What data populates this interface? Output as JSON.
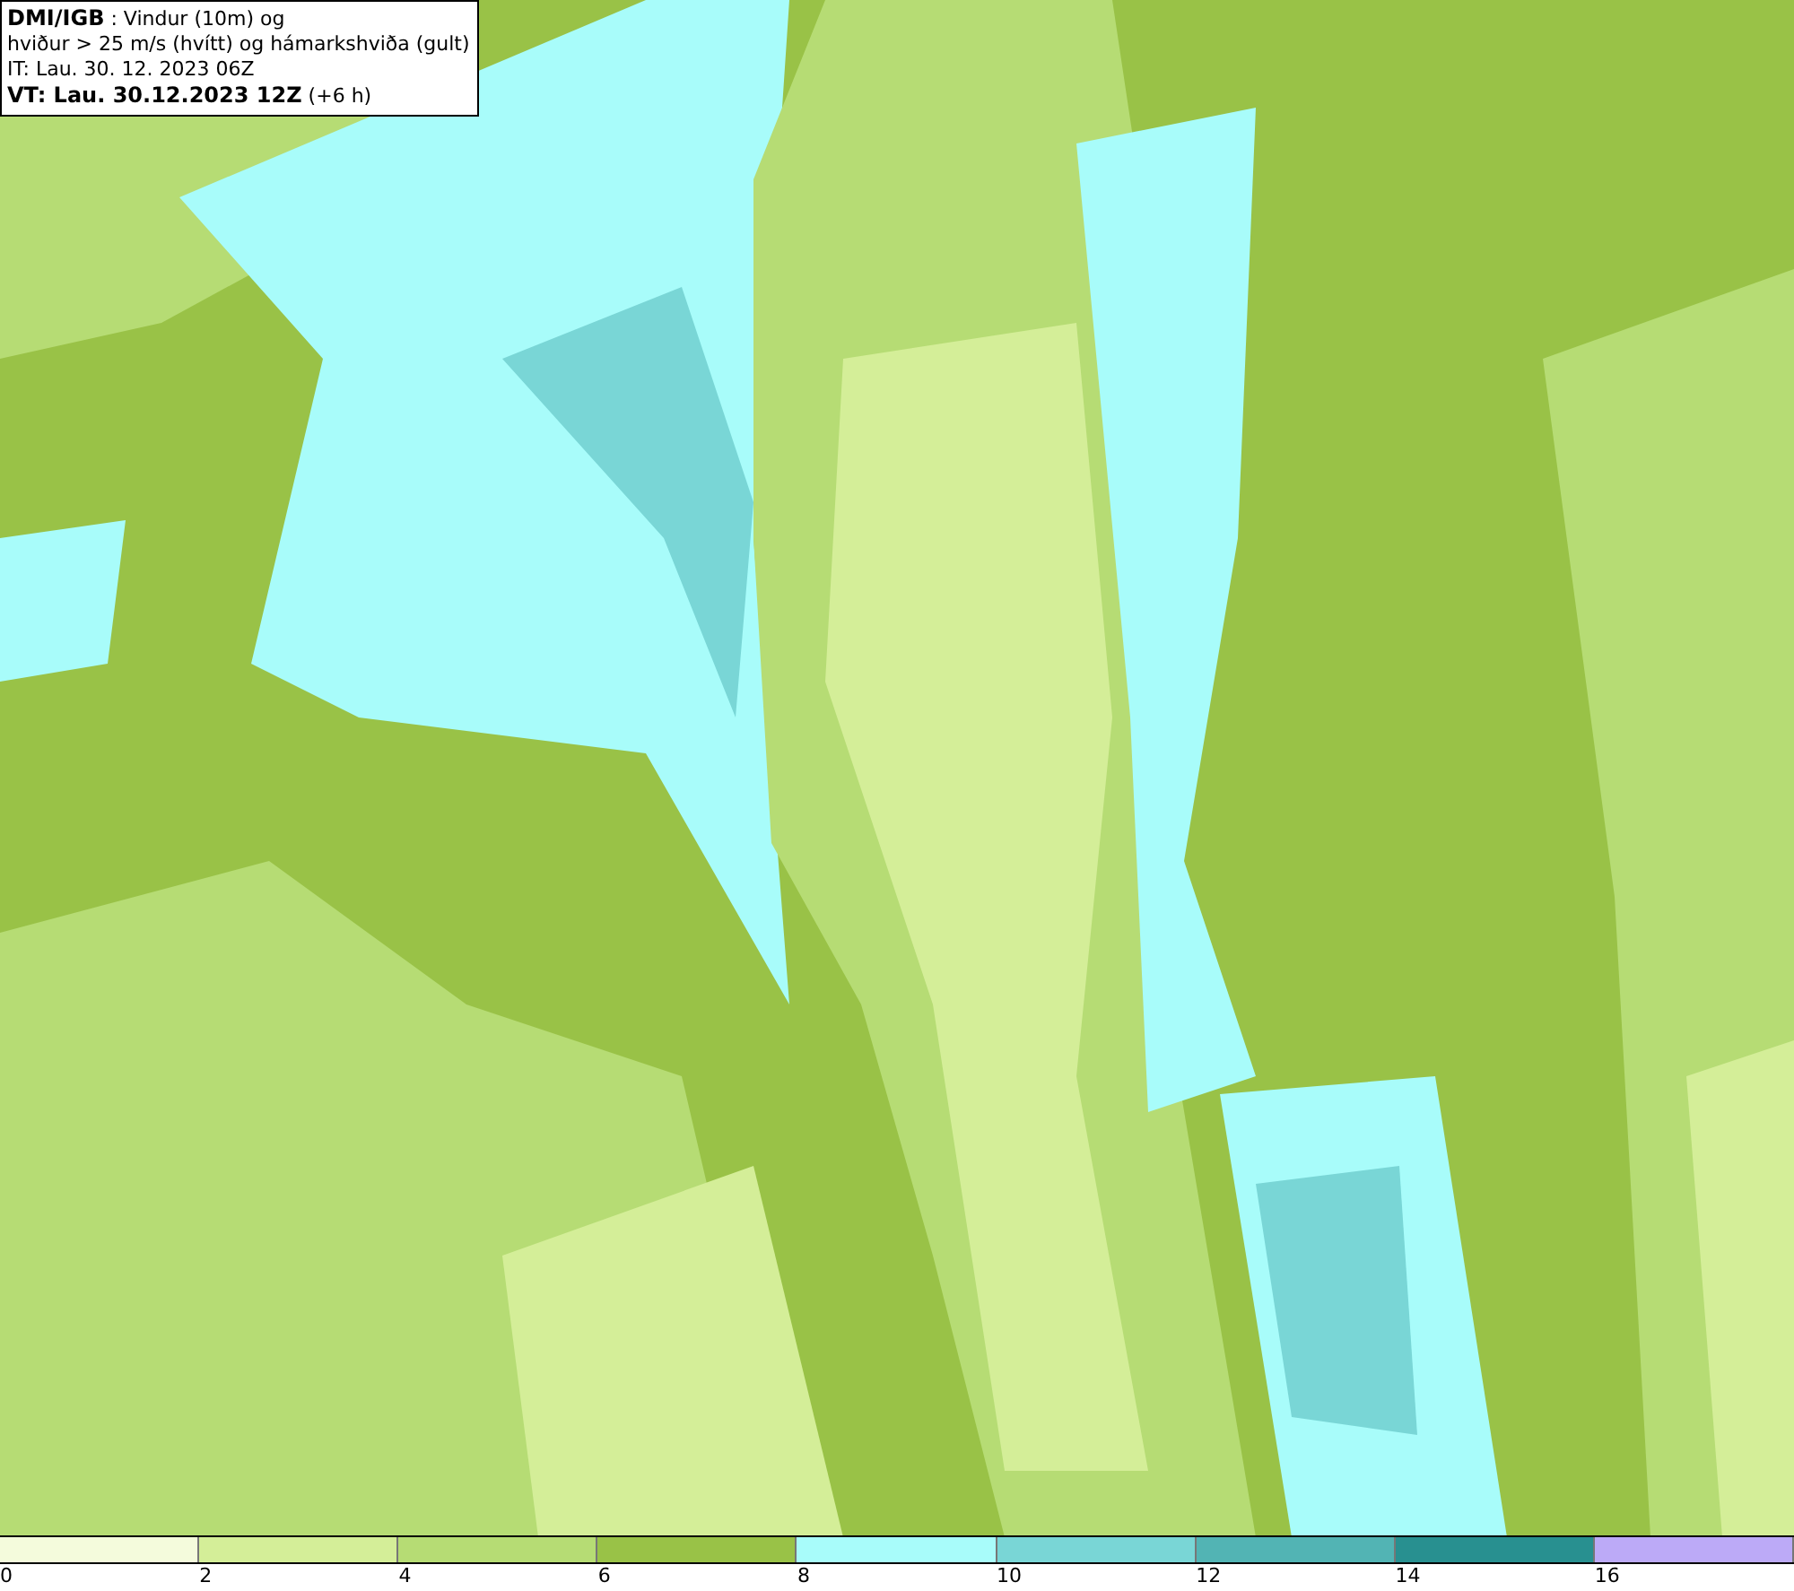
{
  "info_box": {
    "lines": [
      "**DMI/IGB** : Vindur (10m) og",
      "hviður > 25 m/s (hvítt) og hámarkshviða (gult)",
      "IT: Lau. 30. 12. 2023 06Z",
      "**VT: Lau. 30.12.2023 12Z** (+6 h)"
    ]
  },
  "legend": {
    "bins": [
      {
        "label": "0",
        "color": "#f4fbdc"
      },
      {
        "label": "2",
        "color": "#d4ee98"
      },
      {
        "label": "4",
        "color": "#b6dc74"
      },
      {
        "label": "6",
        "color": "#99c247"
      },
      {
        "label": "8",
        "color": "#a8fcfa"
      },
      {
        "label": "10",
        "color": "#79d6d6"
      },
      {
        "label": "12",
        "color": "#52b4b4"
      },
      {
        "label": "14",
        "color": "#289090"
      },
      {
        "label": "16",
        "color": "#bcaaf7"
      }
    ]
  }
}
